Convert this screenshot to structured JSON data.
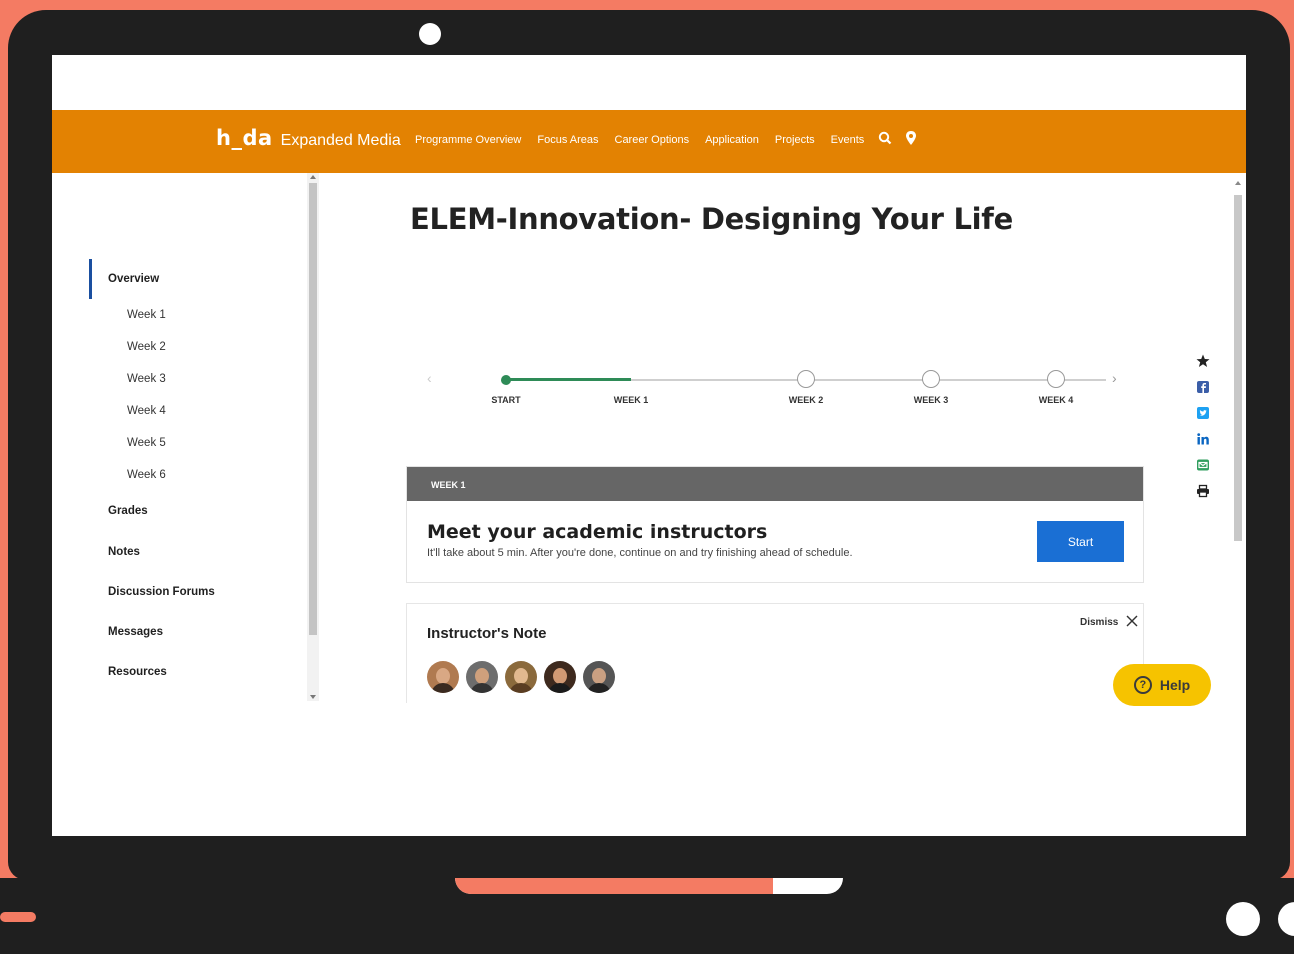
{
  "header": {
    "logo_mark": "h_da",
    "logo_text": "Expanded Media",
    "nav": [
      "Programme Overview",
      "Focus Areas",
      "Career Options",
      "Application",
      "Projects",
      "Events"
    ],
    "icons": [
      "search-icon",
      "location-pin-icon"
    ]
  },
  "sidebar": {
    "items": [
      "Overview",
      "Grades",
      "Notes",
      "Discussion Forums",
      "Messages",
      "Resources"
    ],
    "weeks": [
      "Week 1",
      "Week 2",
      "Week 3",
      "Week 4",
      "Week 5",
      "Week 6"
    ],
    "active": "Overview"
  },
  "course": {
    "title": "ELEM-Innovation- Designing Your Life"
  },
  "timeline": {
    "labels": [
      "START",
      "WEEK 1",
      "WEEK 2",
      "WEEK 3",
      "WEEK 4"
    ],
    "progress_fraction": 0.25
  },
  "week_card": {
    "header": "WEEK 1",
    "title": "Meet your academic instructors",
    "subtitle": "It'll take about 5 min. After you're done, continue on and try finishing ahead of schedule.",
    "button": "Start"
  },
  "note_card": {
    "title": "Instructor's Note",
    "dismiss": "Dismiss",
    "avatar_count": 5
  },
  "social_icons": [
    "star-icon",
    "facebook-icon",
    "twitter-icon",
    "linkedin-icon",
    "email-icon",
    "print-icon"
  ],
  "help": {
    "label": "Help"
  },
  "colors": {
    "topbar": "#e38202",
    "accent_blue": "#1a6fd4",
    "progress_green": "#2e8b57",
    "help_yellow": "#f6c300",
    "background": "#f47b63"
  },
  "device": {
    "hinge_fill_fraction": 0.82
  }
}
